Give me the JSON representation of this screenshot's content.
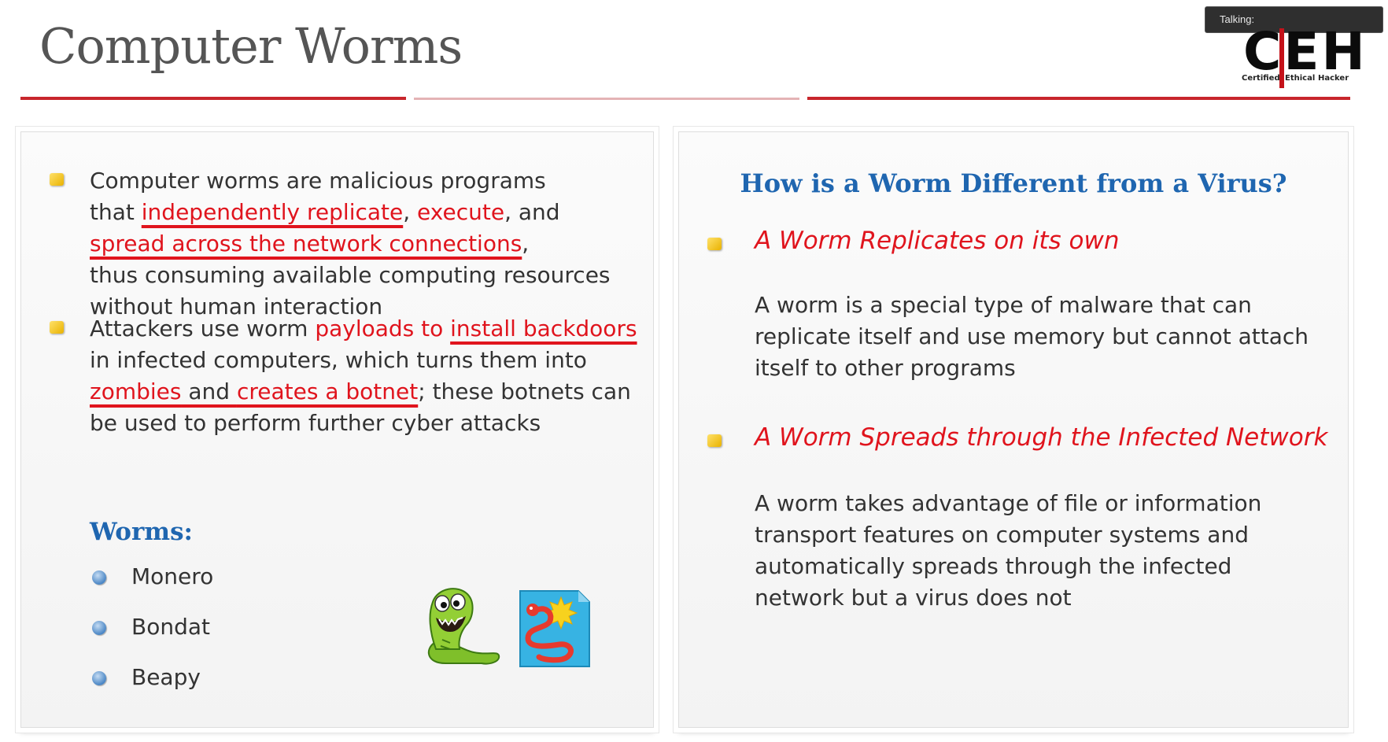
{
  "slide": {
    "title": "Computer Worms"
  },
  "overlay": {
    "talking_label": "Talking:"
  },
  "logo": {
    "letters": "CEH",
    "word1": "Certified",
    "word2": "Ethical",
    "word3": "Hacker"
  },
  "left": {
    "bullet1": {
      "l1": "Computer worms are malicious programs",
      "l2_pre": "that ",
      "l2_hl1": "independently replicate",
      "l2_sep": ", ",
      "l2_hl2": "execute",
      "l2_post": ", and",
      "l3_hl": "spread across the network connections",
      "l3_post": ",",
      "l4": "thus consuming available computing resources",
      "l5": "without human interaction"
    },
    "bullet2": {
      "l1_pre": "Attackers use worm ",
      "l1_hl1": "payloads to ",
      "l1_hl2": "install backdoors",
      "l2": "in infected computers, which turns them into",
      "l3_hl1": "zombies",
      "l3_mid": " and ",
      "l3_hl2": "creates a botnet",
      "l3_post": "; these botnets can",
      "l4": "be used to perform further cyber attacks"
    },
    "worms_heading": "Worms:",
    "worms": [
      "Monero",
      "Bondat",
      "Beapy"
    ]
  },
  "right": {
    "heading": "How is a Worm Different from a Virus?",
    "point1": {
      "title": "A Worm Replicates on its own",
      "lines": [
        "A worm is a special type of malware that can",
        "replicate itself and use memory but cannot attach",
        "itself to other programs"
      ]
    },
    "point2": {
      "title": "A Worm Spreads through the Infected Network",
      "lines": [
        "A worm takes advantage of file or information",
        "transport features on computer systems and",
        "automatically spreads through the infected",
        "network but a virus does not"
      ]
    }
  },
  "colors": {
    "accent_red": "#e0141d",
    "heading_blue": "#1f66b0",
    "bullet_yellow": "#f2c21a",
    "title_gray": "#555555"
  },
  "icons": [
    "square-bullet-icon",
    "round-bullet-icon",
    "worm-mascot-icon",
    "virus-file-icon"
  ]
}
